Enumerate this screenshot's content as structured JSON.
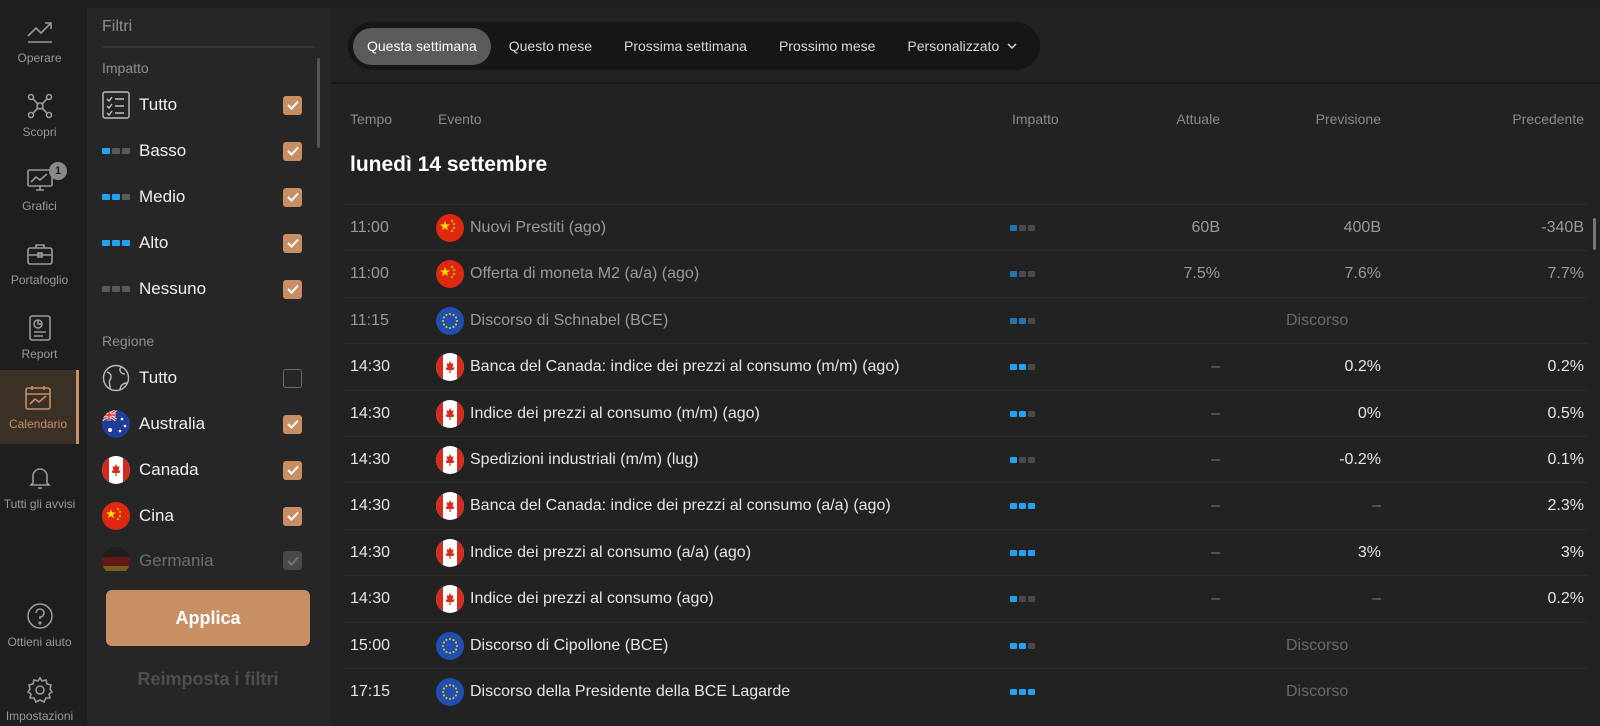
{
  "nav": {
    "items": [
      {
        "label": "Operare",
        "icon": "trend-up-icon"
      },
      {
        "label": "Scopri",
        "icon": "network-icon"
      },
      {
        "label": "Grafici",
        "icon": "chart-monitor-icon",
        "badge": "1"
      },
      {
        "label": "Portafoglio",
        "icon": "briefcase-icon"
      },
      {
        "label": "Report",
        "icon": "report-icon"
      },
      {
        "label": "Calendario",
        "icon": "calendar-icon",
        "active": true
      },
      {
        "label": "Tutti gli avvisi",
        "icon": "bell-icon"
      },
      {
        "label": "Ottieni aiuto",
        "icon": "help-icon"
      },
      {
        "label": "Impostazioni",
        "icon": "gear-icon"
      }
    ]
  },
  "filters": {
    "title": "Filtri",
    "impact_title": "Impatto",
    "impact": [
      {
        "label": "Tutto",
        "checked": true
      },
      {
        "label": "Basso",
        "checked": true,
        "level": 1
      },
      {
        "label": "Medio",
        "checked": true,
        "level": 2
      },
      {
        "label": "Alto",
        "checked": true,
        "level": 3
      },
      {
        "label": "Nessuno",
        "checked": true,
        "level": 0
      }
    ],
    "region_title": "Regione",
    "regions": [
      {
        "label": "Tutto",
        "checked": false
      },
      {
        "label": "Australia",
        "checked": true
      },
      {
        "label": "Canada",
        "checked": true
      },
      {
        "label": "Cina",
        "checked": true
      },
      {
        "label": "Germania",
        "checked": true
      }
    ],
    "apply_label": "Applica",
    "reset_label": "Reimposta i filtri"
  },
  "tabs": [
    {
      "label": "Questa settimana",
      "active": true
    },
    {
      "label": "Questo mese"
    },
    {
      "label": "Prossima settimana"
    },
    {
      "label": "Prossimo mese"
    },
    {
      "label": "Personalizzato",
      "dropdown": true
    }
  ],
  "table": {
    "headers": {
      "time": "Tempo",
      "event": "Evento",
      "impact": "Impatto",
      "actual": "Attuale",
      "forecast": "Previsione",
      "previous": "Precedente"
    },
    "date": "lunedì 14 settembre",
    "rows": [
      {
        "time": "11:00",
        "flag": "cn",
        "event": "Nuovi Prestiti (ago)",
        "impact": 1,
        "actual": "60B",
        "forecast": "400B",
        "previous": "-340B",
        "past": true
      },
      {
        "time": "11:00",
        "flag": "cn",
        "event": "Offerta di moneta M2 (a/a) (ago)",
        "impact": 1,
        "actual": "7.5%",
        "forecast": "7.6%",
        "previous": "7.7%",
        "past": true
      },
      {
        "time": "11:15",
        "flag": "eu",
        "event": "Discorso di Schnabel (BCE)",
        "impact": 2,
        "speech": "Discorso",
        "past": true
      },
      {
        "time": "14:30",
        "flag": "ca",
        "event": "Banca del Canada: indice dei prezzi al consumo (m/m) (ago)",
        "impact": 2,
        "actual": "–",
        "forecast": "0.2%",
        "previous": "0.2%"
      },
      {
        "time": "14:30",
        "flag": "ca",
        "event": "Indice dei prezzi al consumo (m/m) (ago)",
        "impact": 2,
        "actual": "–",
        "forecast": "0%",
        "previous": "0.5%"
      },
      {
        "time": "14:30",
        "flag": "ca",
        "event": "Spedizioni industriali (m/m) (lug)",
        "impact": 1,
        "actual": "–",
        "forecast": "-0.2%",
        "previous": "0.1%"
      },
      {
        "time": "14:30",
        "flag": "ca",
        "event": "Banca del Canada: indice dei prezzi al consumo (a/a) (ago)",
        "impact": 3,
        "actual": "–",
        "forecast": "–",
        "previous": "2.3%"
      },
      {
        "time": "14:30",
        "flag": "ca",
        "event": "Indice dei prezzi al consumo (a/a) (ago)",
        "impact": 3,
        "actual": "–",
        "forecast": "3%",
        "previous": "3%"
      },
      {
        "time": "14:30",
        "flag": "ca",
        "event": "Indice dei prezzi al consumo (ago)",
        "impact": 1,
        "actual": "–",
        "forecast": "–",
        "previous": "0.2%"
      },
      {
        "time": "15:00",
        "flag": "eu",
        "event": "Discorso di Cipollone (BCE)",
        "impact": 2,
        "speech": "Discorso"
      },
      {
        "time": "17:15",
        "flag": "eu",
        "event": "Discorso della Presidente della BCE Lagarde",
        "impact": 3,
        "speech": "Discorso"
      }
    ]
  },
  "colors": {
    "accent": "#c88e64",
    "impact_on": "#22a3f2",
    "background": "#1f1f1f"
  }
}
